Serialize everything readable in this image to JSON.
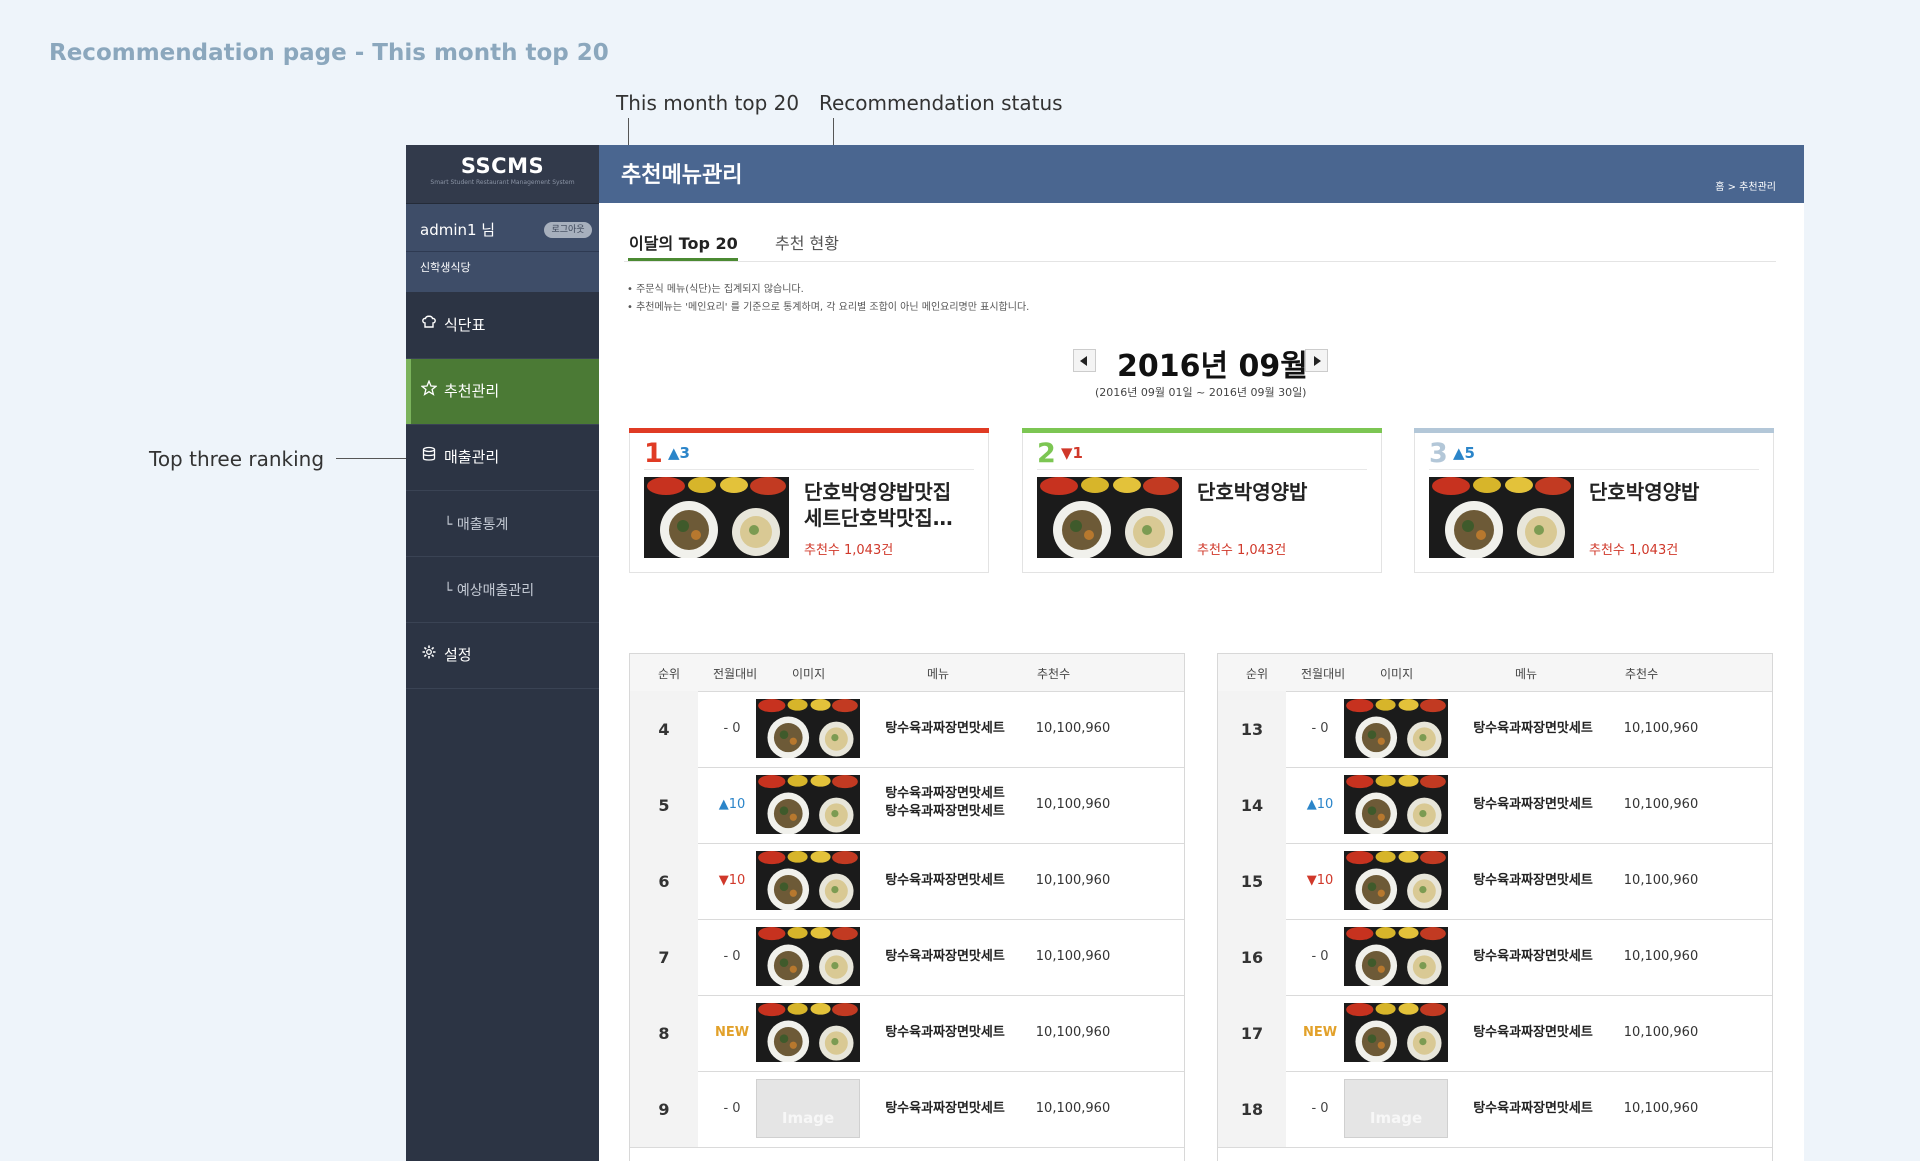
{
  "page_caption": "Recommendation page - This month top 20",
  "annotations": {
    "tab_top20": "This month top 20",
    "tab_status": "Recommendation status",
    "top_three": "Top three ranking"
  },
  "sidebar": {
    "logo": "SSCMS",
    "logo_sub": "Smart Student Restaurant Management System",
    "user": "admin1 님",
    "logout": "로그아웃",
    "cafeteria": "신학생식당",
    "menu": [
      {
        "label": "식단표",
        "icon": "chef-hat-icon"
      },
      {
        "label": "추천관리",
        "icon": "star-icon",
        "active": true
      },
      {
        "label": "매출관리",
        "icon": "database-icon"
      }
    ],
    "submenu": [
      "└ 매출통계",
      "└ 예상매출관리"
    ],
    "settings": {
      "label": "설정",
      "icon": "gear-icon"
    }
  },
  "header": {
    "title": "추천메뉴관리",
    "breadcrumb": "홈 > 추천관리"
  },
  "tabs": [
    "이달의 Top 20",
    "추천 현황"
  ],
  "notes": [
    "• 주문식 메뉴(식단)는 집계되지 않습니다.",
    "• 추천메뉴는 '메인요리' 를 기준으로 통계하며, 각 요리별 조합이 아닌 메인요리명만 표시합니다."
  ],
  "month": {
    "title": "2016년 09월",
    "range": "(2016년 09월 01일 ~ 2016년 09월 30일)"
  },
  "colors": {
    "rank1": "#e03b24",
    "rank2": "#7cc653",
    "rank3": "#b3c7d8",
    "up": "#2b85c9",
    "down": "#d0382a",
    "new": "#e2a12a"
  },
  "top_three": [
    {
      "rank": "1",
      "change": "▲3",
      "dir": "up",
      "name": "단호박영양밥맛집 세트단호박맛집…",
      "count": "추천수 1,043건"
    },
    {
      "rank": "2",
      "change": "▼1",
      "dir": "down",
      "name": "단호박영양밥",
      "count": "추천수 1,043건"
    },
    {
      "rank": "3",
      "change": "▲5",
      "dir": "up",
      "name": "단호박영양밥",
      "count": "추천수 1,043건"
    }
  ],
  "table_headers": [
    "순위",
    "전월대비",
    "이미지",
    "메뉴",
    "추천수"
  ],
  "table_left": [
    {
      "rank": "4",
      "change": "- 0",
      "dir": "same",
      "menu": "탕수육과짜장면맛세트",
      "count": "10,100,960"
    },
    {
      "rank": "5",
      "change": "▲10",
      "dir": "up",
      "menu": "탕수육과짜장면맛세트\n탕수육과짜장면맛세트",
      "count": "10,100,960"
    },
    {
      "rank": "6",
      "change": "▼10",
      "dir": "down",
      "menu": "탕수육과짜장면맛세트",
      "count": "10,100,960"
    },
    {
      "rank": "7",
      "change": "- 0",
      "dir": "same",
      "menu": "탕수육과짜장면맛세트",
      "count": "10,100,960"
    },
    {
      "rank": "8",
      "change": "NEW",
      "dir": "new",
      "menu": "탕수육과짜장면맛세트",
      "count": "10,100,960"
    },
    {
      "rank": "9",
      "change": "- 0",
      "dir": "same",
      "menu": "탕수육과짜장면맛세트",
      "count": "10,100,960",
      "image": "Image"
    }
  ],
  "table_right": [
    {
      "rank": "13",
      "change": "- 0",
      "dir": "same",
      "menu": "탕수육과짜장면맛세트",
      "count": "10,100,960"
    },
    {
      "rank": "14",
      "change": "▲10",
      "dir": "up",
      "menu": "탕수육과짜장면맛세트",
      "count": "10,100,960"
    },
    {
      "rank": "15",
      "change": "▼10",
      "dir": "down",
      "menu": "탕수육과짜장면맛세트",
      "count": "10,100,960"
    },
    {
      "rank": "16",
      "change": "- 0",
      "dir": "same",
      "menu": "탕수육과짜장면맛세트",
      "count": "10,100,960"
    },
    {
      "rank": "17",
      "change": "NEW",
      "dir": "new",
      "menu": "탕수육과짜장면맛세트",
      "count": "10,100,960"
    },
    {
      "rank": "18",
      "change": "- 0",
      "dir": "same",
      "menu": "탕수육과짜장면맛세트",
      "count": "10,100,960",
      "image": "Image"
    }
  ]
}
